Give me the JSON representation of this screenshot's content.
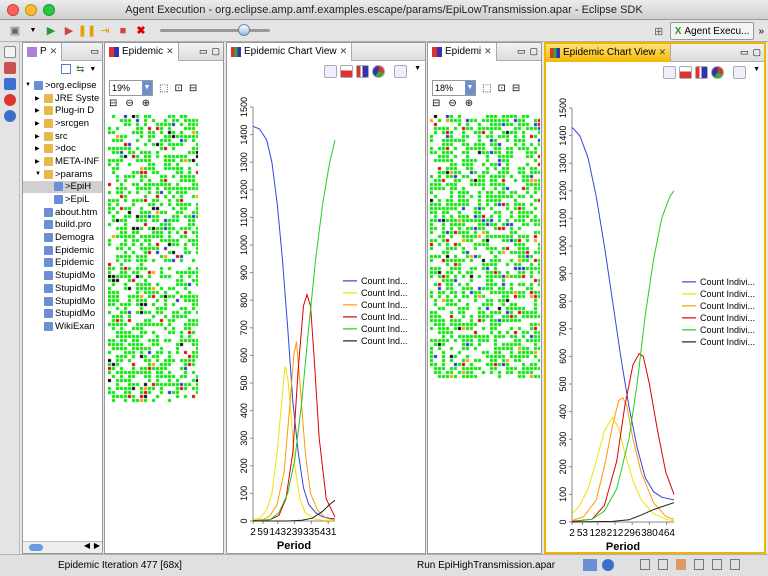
{
  "window": {
    "title": "Agent Execution - org.eclipse.amp.amf.examples.escape/params/EpiLowTransmission.apar - Eclipse SDK"
  },
  "perspective": {
    "label": "Agent Execu..."
  },
  "package_explorer": {
    "tab_label": "P",
    "items": [
      {
        "label": ">org.eclipse",
        "indent": 0,
        "arrow": "▼"
      },
      {
        "label": "JRE Syste",
        "indent": 1,
        "arrow": "▶"
      },
      {
        "label": "Plug-in D",
        "indent": 1,
        "arrow": "▶"
      },
      {
        "label": ">srcgen",
        "indent": 1,
        "arrow": "▶"
      },
      {
        "label": "src",
        "indent": 1,
        "arrow": "▶"
      },
      {
        "label": ">doc",
        "indent": 1,
        "arrow": "▶"
      },
      {
        "label": "META-INF",
        "indent": 1,
        "arrow": "▶"
      },
      {
        "label": ">params",
        "indent": 1,
        "arrow": "▼"
      },
      {
        "label": ">EpiH",
        "indent": 2,
        "arrow": "",
        "selected": true
      },
      {
        "label": ">EpiL",
        "indent": 2,
        "arrow": ""
      },
      {
        "label": "about.htm",
        "indent": 1,
        "arrow": ""
      },
      {
        "label": "build.pro",
        "indent": 1,
        "arrow": ""
      },
      {
        "label": "Demogra",
        "indent": 1,
        "arrow": ""
      },
      {
        "label": "Epidemic",
        "indent": 1,
        "arrow": ""
      },
      {
        "label": "Epidemic",
        "indent": 1,
        "arrow": ""
      },
      {
        "label": "StupidMo",
        "indent": 1,
        "arrow": ""
      },
      {
        "label": "StupidMo",
        "indent": 1,
        "arrow": ""
      },
      {
        "label": "StupidMo",
        "indent": 1,
        "arrow": ""
      },
      {
        "label": "StupidMo",
        "indent": 1,
        "arrow": ""
      },
      {
        "label": "WikiExan",
        "indent": 1,
        "arrow": ""
      }
    ]
  },
  "grid_view_1": {
    "tab_label": "Epidemic",
    "zoom": "19%"
  },
  "chart_view_1": {
    "tab_label": "Epidemic Chart View"
  },
  "grid_view_2": {
    "tab_label": "Epidemi",
    "zoom": "18%"
  },
  "chart_view_2": {
    "tab_label": "Epidemic Chart View"
  },
  "status": {
    "left": "Epidemic Iteration 477 [68x]",
    "middle": "Run EpiHighTransmission.apar"
  },
  "colors": {
    "agent_green": "#00e600",
    "selected_tab": "#f5b800"
  },
  "chart_data": [
    {
      "type": "line",
      "xlabel": "Period",
      "x_ticks": [
        "2",
        "59",
        "143",
        "239",
        "335",
        "431"
      ],
      "y_ticks": [
        "0",
        "100",
        "200",
        "300",
        "400",
        "500",
        "600",
        "700",
        "800",
        "900",
        "1000",
        "1100",
        "1200",
        "1300",
        "1400",
        "1500"
      ],
      "ylim": [
        0,
        1500
      ],
      "xlim": [
        2,
        470
      ],
      "legend": [
        {
          "name": "Count Ind...",
          "color": "#3344dd"
        },
        {
          "name": "Count Ind...",
          "color": "#f0e000"
        },
        {
          "name": "Count Ind...",
          "color": "#ff9900"
        },
        {
          "name": "Count Ind...",
          "color": "#dd0000"
        },
        {
          "name": "Count Ind...",
          "color": "#22cc22"
        },
        {
          "name": "Count Ind...",
          "color": "#222222"
        }
      ],
      "series": [
        {
          "x": [
            2,
            40,
            80,
            110,
            140,
            170,
            200,
            230,
            260,
            290,
            320,
            360,
            400,
            440,
            470
          ],
          "values": [
            1430,
            1420,
            1380,
            1300,
            1150,
            950,
            700,
            430,
            250,
            120,
            60,
            30,
            15,
            10,
            8
          ]
        },
        {
          "x": [
            2,
            40,
            80,
            110,
            140,
            170,
            185,
            200,
            220,
            240,
            270,
            300,
            350,
            400,
            470
          ],
          "values": [
            5,
            10,
            40,
            100,
            250,
            460,
            560,
            520,
            380,
            200,
            80,
            30,
            8,
            3,
            1
          ]
        },
        {
          "x": [
            2,
            60,
            100,
            140,
            180,
            210,
            235,
            250,
            270,
            300,
            330,
            370,
            420,
            470
          ],
          "values": [
            2,
            5,
            20,
            60,
            180,
            400,
            600,
            650,
            500,
            250,
            100,
            40,
            10,
            3
          ]
        },
        {
          "x": [
            2,
            100,
            150,
            190,
            230,
            260,
            290,
            310,
            330,
            350,
            380,
            420,
            470
          ],
          "values": [
            1,
            5,
            20,
            80,
            250,
            550,
            780,
            820,
            780,
            600,
            300,
            80,
            15
          ]
        },
        {
          "x": [
            2,
            100,
            150,
            200,
            240,
            280,
            320,
            360,
            400,
            440,
            470
          ],
          "values": [
            0,
            5,
            30,
            100,
            220,
            430,
            700,
            950,
            1150,
            1300,
            1380
          ]
        },
        {
          "x": [
            2,
            200,
            280,
            340,
            400,
            440,
            470
          ],
          "values": [
            0,
            0,
            3,
            10,
            35,
            60,
            75
          ]
        }
      ]
    },
    {
      "type": "line",
      "xlabel": "Period",
      "x_ticks": [
        "2",
        "53",
        "128",
        "212",
        "296",
        "380",
        "464"
      ],
      "y_ticks": [
        "0",
        "100",
        "200",
        "300",
        "400",
        "500",
        "600",
        "700",
        "800",
        "900",
        "1000",
        "1100",
        "1200",
        "1300",
        "1400",
        "1500"
      ],
      "ylim": [
        0,
        1500
      ],
      "xlim": [
        2,
        500
      ],
      "legend": [
        {
          "name": "Count Indivi...",
          "color": "#3344dd"
        },
        {
          "name": "Count Indivi...",
          "color": "#f0e000"
        },
        {
          "name": "Count Indivi...",
          "color": "#ff9900"
        },
        {
          "name": "Count Indivi...",
          "color": "#dd0000"
        },
        {
          "name": "Count Indivi...",
          "color": "#22cc22"
        },
        {
          "name": "Count Indivi...",
          "color": "#222222"
        }
      ],
      "series": [
        {
          "x": [
            2,
            40,
            80,
            120,
            160,
            200,
            240,
            280,
            320,
            360,
            400,
            440,
            500
          ],
          "values": [
            1430,
            1400,
            1320,
            1180,
            1000,
            800,
            600,
            420,
            270,
            160,
            110,
            90,
            80
          ]
        },
        {
          "x": [
            2,
            40,
            80,
            120,
            160,
            200,
            230,
            260,
            300,
            340,
            400,
            460,
            500
          ],
          "values": [
            30,
            60,
            120,
            220,
            330,
            380,
            340,
            250,
            150,
            80,
            30,
            10,
            5
          ]
        },
        {
          "x": [
            2,
            60,
            120,
            160,
            200,
            230,
            250,
            270,
            300,
            340,
            400,
            460,
            500
          ],
          "values": [
            5,
            20,
            80,
            200,
            350,
            440,
            450,
            420,
            300,
            180,
            70,
            20,
            10
          ]
        },
        {
          "x": [
            2,
            100,
            160,
            220,
            260,
            300,
            330,
            350,
            380,
            420,
            460,
            500
          ],
          "values": [
            2,
            10,
            60,
            220,
            420,
            570,
            610,
            600,
            500,
            330,
            180,
            100
          ]
        },
        {
          "x": [
            2,
            100,
            160,
            220,
            280,
            320,
            360,
            400,
            440,
            480,
            500
          ],
          "values": [
            0,
            10,
            40,
            120,
            300,
            500,
            750,
            950,
            1100,
            1180,
            1200
          ]
        },
        {
          "x": [
            2,
            200,
            280,
            340,
            400,
            460,
            500
          ],
          "values": [
            0,
            2,
            8,
            25,
            45,
            60,
            70
          ]
        }
      ]
    }
  ]
}
